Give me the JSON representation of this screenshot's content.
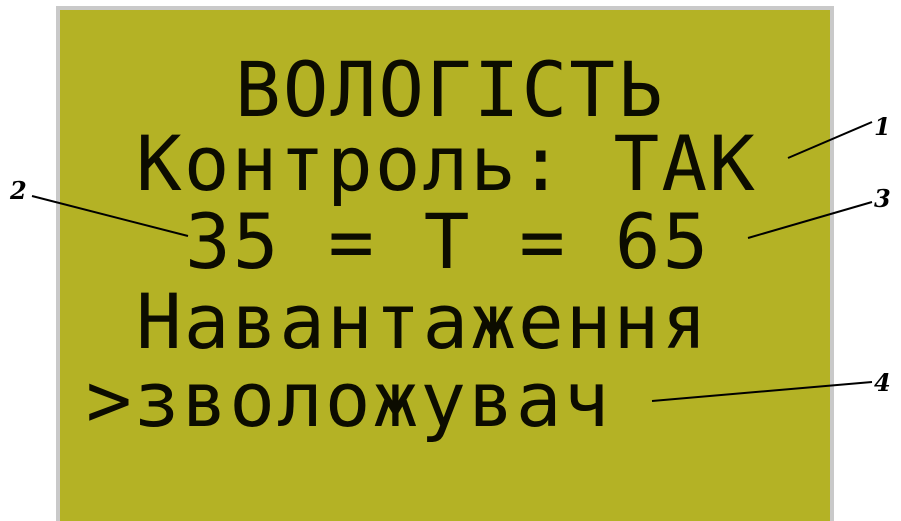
{
  "lcd": {
    "lines": [
      "ВОЛОГІСТЬ",
      "Контроль: ТАК",
      "35 = Т = 65",
      "Навантаження",
      ">зволожувач"
    ]
  },
  "callouts": [
    "1",
    "2",
    "3",
    "4"
  ],
  "colors": {
    "screen_background": "#b4b225",
    "text": "#0c0c00",
    "frame": "#c9c9c9"
  }
}
